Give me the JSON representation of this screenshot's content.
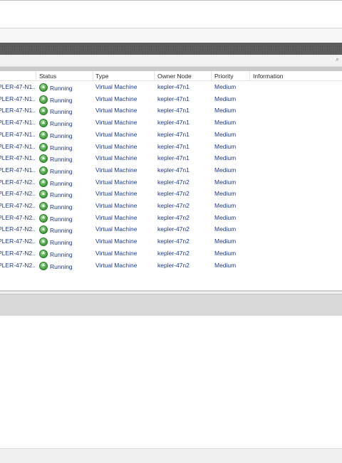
{
  "columns": {
    "status": "Status",
    "type": "Type",
    "owner_node": "Owner Node",
    "priority": "Priority",
    "information": "Information"
  },
  "rows": [
    {
      "name": "PLER-47-N1...",
      "status": "Running",
      "type": "Virtual Machine",
      "owner": "kepler-47n1",
      "priority": "Medium"
    },
    {
      "name": "PLER-47-N1...",
      "status": "Running",
      "type": "Virtual Machine",
      "owner": "kepler-47n1",
      "priority": "Medium"
    },
    {
      "name": "PLER-47-N1...",
      "status": "Running",
      "type": "Virtual Machine",
      "owner": "kepler-47n1",
      "priority": "Medium"
    },
    {
      "name": "PLER-47-N1...",
      "status": "Running",
      "type": "Virtual Machine",
      "owner": "kepler-47n1",
      "priority": "Medium"
    },
    {
      "name": "PLER-47-N1...",
      "status": "Running",
      "type": "Virtual Machine",
      "owner": "kepler-47n1",
      "priority": "Medium"
    },
    {
      "name": "PLER-47-N1...",
      "status": "Running",
      "type": "Virtual Machine",
      "owner": "kepler-47n1",
      "priority": "Medium"
    },
    {
      "name": "PLER-47-N1...",
      "status": "Running",
      "type": "Virtual Machine",
      "owner": "kepler-47n1",
      "priority": "Medium"
    },
    {
      "name": "PLER-47-N1...",
      "status": "Running",
      "type": "Virtual Machine",
      "owner": "kepler-47n1",
      "priority": "Medium"
    },
    {
      "name": "PLER-47-N2...",
      "status": "Running",
      "type": "Virtual Machine",
      "owner": "kepler-47n2",
      "priority": "Medium"
    },
    {
      "name": "PLER-47-N2...",
      "status": "Running",
      "type": "Virtual Machine",
      "owner": "kepler-47n2",
      "priority": "Medium"
    },
    {
      "name": "PLER-47-N2...",
      "status": "Running",
      "type": "Virtual Machine",
      "owner": "kepler-47n2",
      "priority": "Medium"
    },
    {
      "name": "PLER-47-N2...",
      "status": "Running",
      "type": "Virtual Machine",
      "owner": "kepler-47n2",
      "priority": "Medium"
    },
    {
      "name": "PLER-47-N2...",
      "status": "Running",
      "type": "Virtual Machine",
      "owner": "kepler-47n2",
      "priority": "Medium"
    },
    {
      "name": "PLER-47-N2...",
      "status": "Running",
      "type": "Virtual Machine",
      "owner": "kepler-47n2",
      "priority": "Medium"
    },
    {
      "name": "PLER-47-N2...",
      "status": "Running",
      "type": "Virtual Machine",
      "owner": "kepler-47n2",
      "priority": "Medium"
    },
    {
      "name": "PLER-47-N2...",
      "status": "Running",
      "type": "Virtual Machine",
      "owner": "kepler-47n2",
      "priority": "Medium"
    }
  ],
  "icons": {
    "status": "running-arrow-icon",
    "search": "search-icon"
  },
  "colors": {
    "text_link": "#1e3b8a",
    "header_bar": "#5a5a5a",
    "running_green": "#3f9b3a"
  }
}
